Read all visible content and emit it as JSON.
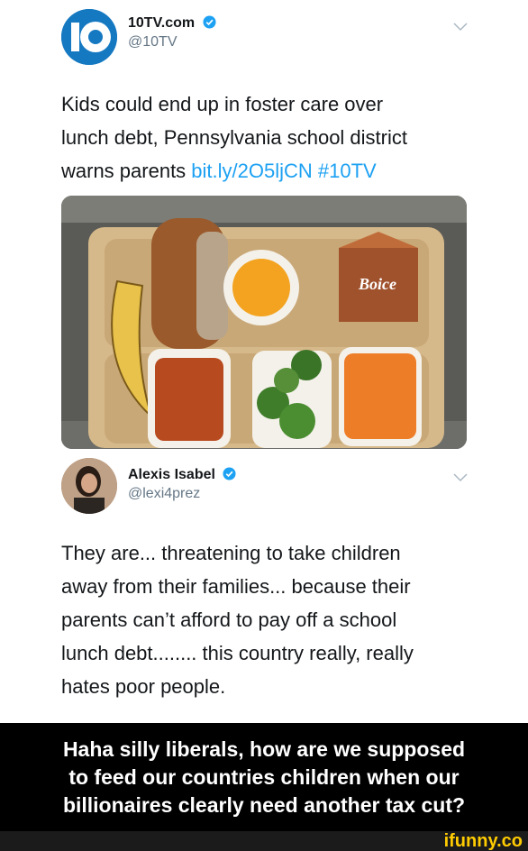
{
  "tweet1": {
    "name": "10TV.com",
    "handle": "@10TV",
    "avatar_text": "10",
    "line1": "Kids could end up in foster care over",
    "line2": "lunch debt, Pennsylvania school district",
    "line3_prefix": "warns parents ",
    "link": "bit.ly/2O5ljCN",
    "hashtag": "#10TV",
    "image_alt": "school lunch tray with sandwich, banana, oranges, milk carton, beans, broccoli and carrots",
    "milk_label": "Boice"
  },
  "tweet2": {
    "name": "Alexis Isabel",
    "handle": "@lexi4prez",
    "lines": [
      "They are... threatening to take children",
      "away from their families... because their",
      "parents can’t afford to pay off a school",
      "lunch debt........ this country really, really",
      "hates poor people."
    ]
  },
  "caption": {
    "line1": "Haha silly liberals, how are we supposed",
    "line2": "to feed our countries children when our",
    "line3": "billionaires clearly need another tax cut?"
  },
  "footer": {
    "brand": "ifunny.co"
  },
  "colors": {
    "link": "#1da1f2",
    "verified": "#1da1f2",
    "brand": "#ffcc00"
  }
}
